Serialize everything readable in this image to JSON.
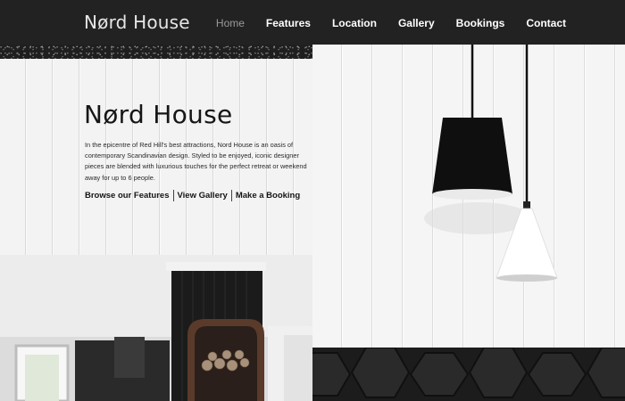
{
  "header": {
    "brand": "Nørd House",
    "nav": [
      {
        "label": "Home",
        "active": true
      },
      {
        "label": "Features",
        "active": false
      },
      {
        "label": "Location",
        "active": false
      },
      {
        "label": "Gallery",
        "active": false
      },
      {
        "label": "Bookings",
        "active": false
      },
      {
        "label": "Contact",
        "active": false
      }
    ]
  },
  "hero": {
    "title": "Nørd House",
    "description": "In the epicentre of Red Hill's best attractions, Nord House is an oasis of contemporary Scandinavian design. Styled to be enjoyed, iconic designer pieces are blended with luxurious touches for the perfect retreat or weekend away for up to 6 people.",
    "links": [
      {
        "label": "Browse our Features"
      },
      {
        "label": "View Gallery"
      },
      {
        "label": "Make a Booking"
      }
    ]
  },
  "colors": {
    "nav_background": "#222222",
    "nav_text": "#ffffff",
    "nav_active_text": "#9a9a9a",
    "title_text": "#161616"
  },
  "images": {
    "right_hero": "pendant-lamps-photo",
    "bottom_left": "dark-kitchen-interior-photo",
    "bottom_right": "black-hex-tiles-photo"
  }
}
